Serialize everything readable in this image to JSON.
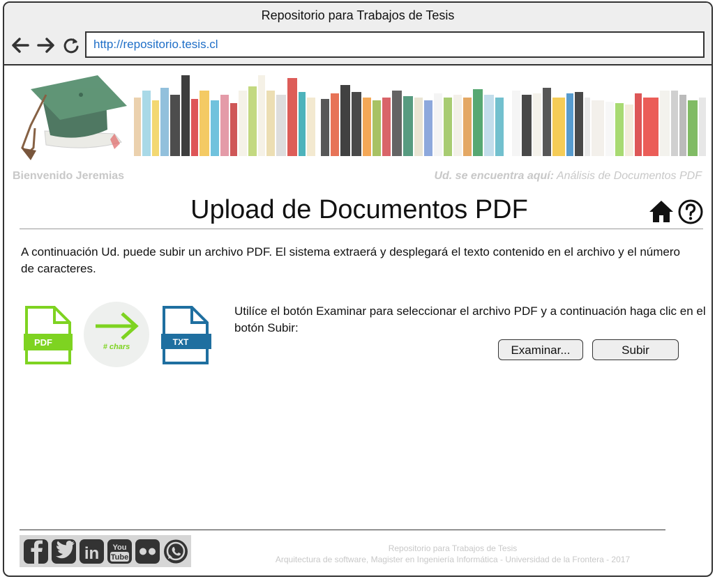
{
  "window": {
    "title": "Repositorio para Trabajos de Tesis"
  },
  "browser": {
    "url": "http://repositorio.tesis.cl"
  },
  "header": {
    "welcome": "Bienvenido Jeremias",
    "breadcrumb_label": "Ud. se encuentra aquí:",
    "breadcrumb_value": "Análisis de Documentos PDF"
  },
  "main": {
    "title": "Upload de Documentos PDF",
    "intro": "A continuación Ud. puede subir un archivo PDF. El sistema extraerá y desplegará el texto contenido en el archivo y el número de caracteres.",
    "instructions": "Utilíce el botón Examinar para seleccionar el archivo PDF y a continuación haga clic en el botón Subir:",
    "examinar_label": "Examinar...",
    "subir_label": "Subir",
    "pdf_icon_label": "PDF",
    "chars_label": "# chars",
    "txt_icon_label": "TXT"
  },
  "footer": {
    "line1": "Repositorio para Trabajos de Tesis",
    "line2": "Arquitectura de software, Magister en Ingeniería Informática - Universidad de la Frontera - 2017",
    "social": [
      "facebook-icon",
      "twitter-icon",
      "linkedin-icon",
      "youtube-icon",
      "flickr-icon",
      "whatsapp-icon"
    ],
    "youtube_line1": "You",
    "youtube_line2": "Tube",
    "linkedin_text": "in"
  },
  "colors": {
    "green": "#7ed321",
    "blue": "#1f6fa0",
    "link": "#1e6ec7",
    "muted": "#c8c8c8"
  },
  "icons": [
    "back-icon",
    "forward-icon",
    "reload-icon",
    "home-icon",
    "help-icon"
  ]
}
